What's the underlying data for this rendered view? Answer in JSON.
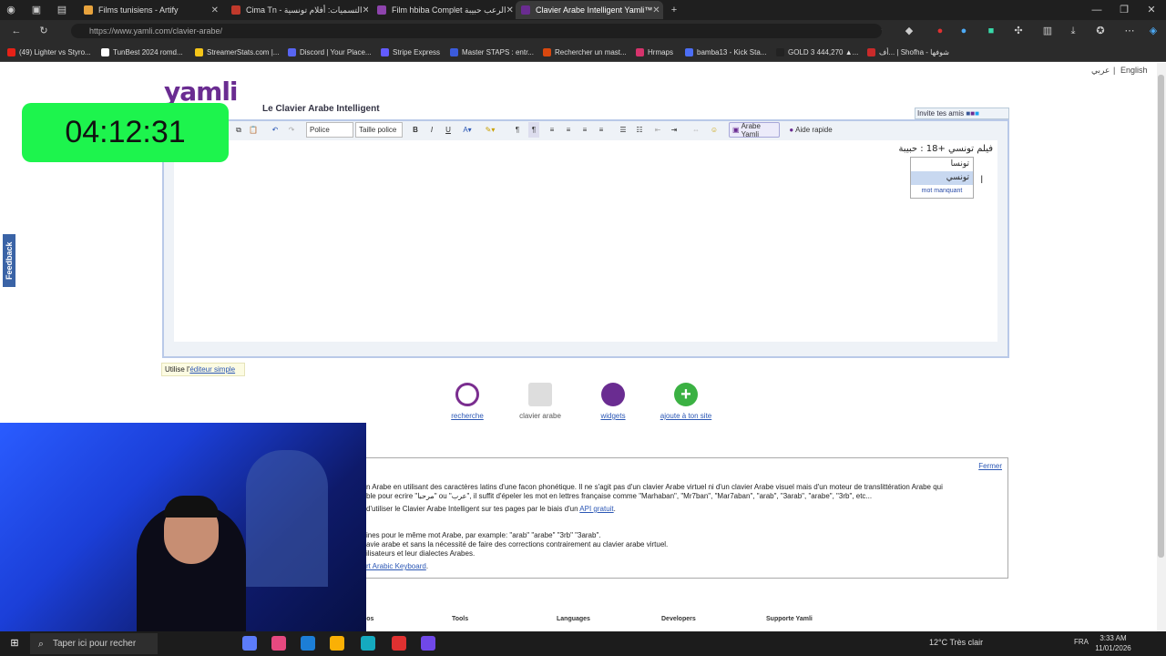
{
  "browser": {
    "tabs": [
      {
        "title": "Films tunisiens - Artify",
        "color": "#e8a33d"
      },
      {
        "title": "Cima Tn - التسميات: أفلام تونسية",
        "color": "#c0392b"
      },
      {
        "title": "Film hbiba Complet الرعب حبيبة",
        "color": "#8e44ad"
      },
      {
        "title": "Clavier Arabe Intelligent Yamli™",
        "color": "#6a2c91"
      }
    ],
    "url": "https://www.yamli.com/clavier-arabe/",
    "bookmarks": [
      {
        "label": "(49) Lighter vs Styro...",
        "color": "#e62117"
      },
      {
        "label": "TunBest 2024 romd...",
        "color": "#ffffff"
      },
      {
        "label": "StreamerStats.com |...",
        "color": "#f5c518"
      },
      {
        "label": "Discord | Your Place...",
        "color": "#5865f2"
      },
      {
        "label": "Stripe Express",
        "color": "#635bff"
      },
      {
        "label": "Master STAPS : entr...",
        "color": "#3b5bdb"
      },
      {
        "label": "Rechercher un mast...",
        "color": "#d9480f"
      },
      {
        "label": "Hrmaps",
        "color": "#d6336c"
      },
      {
        "label": "bamba13 - Kick Sta...",
        "color": "#4c6ef5"
      },
      {
        "label": "GOLD 3 444,270 ▲...",
        "color": "#222222"
      },
      {
        "label": "أف... | Shofha - شوفها",
        "color": "#c92a2a"
      }
    ]
  },
  "page": {
    "lang_arabic": "عربي",
    "lang_english": "English",
    "logo": "yamli",
    "tagline": "Le Clavier Arabe Intelligent",
    "invite": "Invite tes amis",
    "toolbar": {
      "font": "Police",
      "size": "Taille police",
      "bold": "B",
      "italic": "I",
      "underline": "U",
      "arabe_yamli": "Arabe Yamli",
      "aide": "Aide rapide"
    },
    "editor_text": "فيلم تونسي +18 : حبيبة",
    "suggestions": [
      "تونسا",
      "تونسي"
    ],
    "missing": "mot manquant",
    "timer": "04:12:31",
    "feedback": "Feedback",
    "simple_prefix": "Utilise l'",
    "simple_link": "éditeur simple",
    "features": [
      {
        "label": "recherche",
        "color": "#7a2d8f"
      },
      {
        "label": "clavier arabe",
        "color": "#cfcfcf"
      },
      {
        "label": "widgets",
        "color": "#6a2c91"
      },
      {
        "label": "ajoute à ton site",
        "color": "#3bb143"
      }
    ],
    "info": {
      "close": "Fermer",
      "line1": "n Arabe en utilisant des caractères latins d'une facon phonétique. Il ne s'agit pas d'un clavier Arabe virtuel ni d'un clavier Arabe visuel mais d'un moteur de translittération Arabe qui",
      "line2": "ble pour ecrire \"مرحبا\" ou \"عرب\", il suffit d'épeler les mot en lettres française comme \"Marhaban\", \"Mr7ban\", \"Mar7aban\", \"arab\", \"3arab\", \"arabe\", \"3rb\", etc...",
      "line3": "d'utiliser le Clavier Arabe Intelligent sur tes pages par le biais d'un",
      "line3_link": "API gratuit",
      "line4": "ines pour le même mot Arabe, par example: \"arab\" \"arabe\" \"3rb\" \"3arab\".",
      "line5": "avie arabe et sans la nécessité de faire des corrections contrairement au clavier arabe virtuel.",
      "line6": "ilisateurs et leur dialectes Arabes.",
      "line7": "rt Arabic Keyboard"
    },
    "footer": [
      "pos",
      "Tools",
      "Languages",
      "Developers",
      "Supporte Yamli"
    ]
  },
  "taskbar": {
    "search": "Taper ici pour recher",
    "weather": "12°C  Très clair",
    "lang": "FRA",
    "time": "3:33 AM",
    "date": "11/01/2026"
  }
}
